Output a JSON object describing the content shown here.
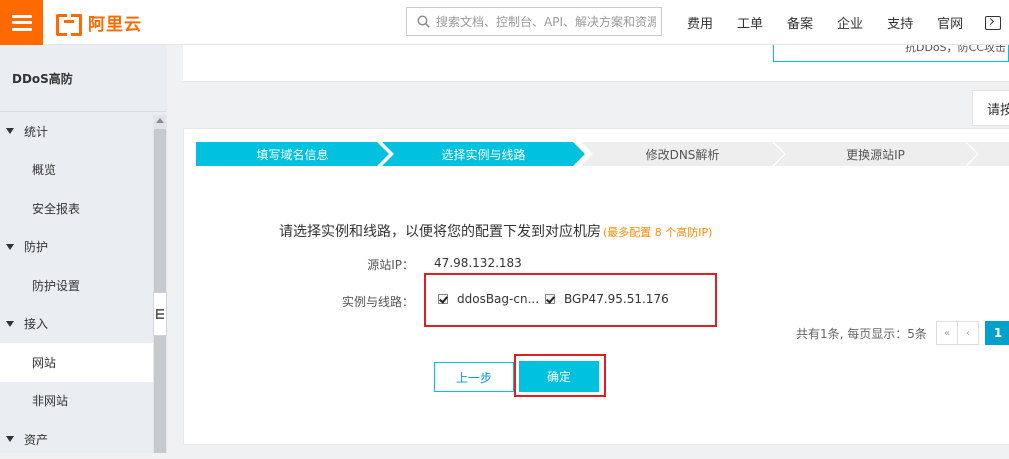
{
  "brand": {
    "logo_text": "阿里云",
    "accent": "#ff6a00"
  },
  "search": {
    "placeholder": "搜索文档、控制台、API、解决方案和资源"
  },
  "topnav": [
    "费用",
    "工单",
    "备案",
    "企业",
    "支持",
    "官网"
  ],
  "sidebar": {
    "title": "DDoS高防",
    "items": [
      {
        "label": "统计",
        "type": "group"
      },
      {
        "label": "概览",
        "type": "sub"
      },
      {
        "label": "安全报表",
        "type": "sub"
      },
      {
        "label": "防护",
        "type": "group"
      },
      {
        "label": "防护设置",
        "type": "sub"
      },
      {
        "label": "接入",
        "type": "group"
      },
      {
        "label": "网站",
        "type": "sub",
        "active": true
      },
      {
        "label": "非网站",
        "type": "sub"
      },
      {
        "label": "资产",
        "type": "group"
      }
    ]
  },
  "notice": {
    "text": "抗DDoS，防CC攻击"
  },
  "tip_tab": {
    "label": "请按"
  },
  "steps": {
    "items": [
      "填写域名信息",
      "选择实例与线路",
      "修改DNS解析",
      "更换源站IP",
      ""
    ],
    "active_color": "#00c1de",
    "inactive_color": "#eeeeee"
  },
  "form": {
    "heading": "请选择实例和线路，以便将您的配置下发到对应机房",
    "heading_hint": "(最多配置 8 个高防IP)",
    "source_ip_label": "源站IP：",
    "source_ip_value": "47.98.132.183",
    "instance_label": "实例与线路：",
    "instances": [
      {
        "label": "ddosBag-cn...",
        "checked": true
      },
      {
        "label": "BGP47.95.51.176",
        "checked": true
      }
    ]
  },
  "pager": {
    "summary": "共有1条, 每页显示：5条",
    "first": "«",
    "prev": "‹",
    "current": "1"
  },
  "buttons": {
    "prev": "上一步",
    "ok": "确定"
  }
}
